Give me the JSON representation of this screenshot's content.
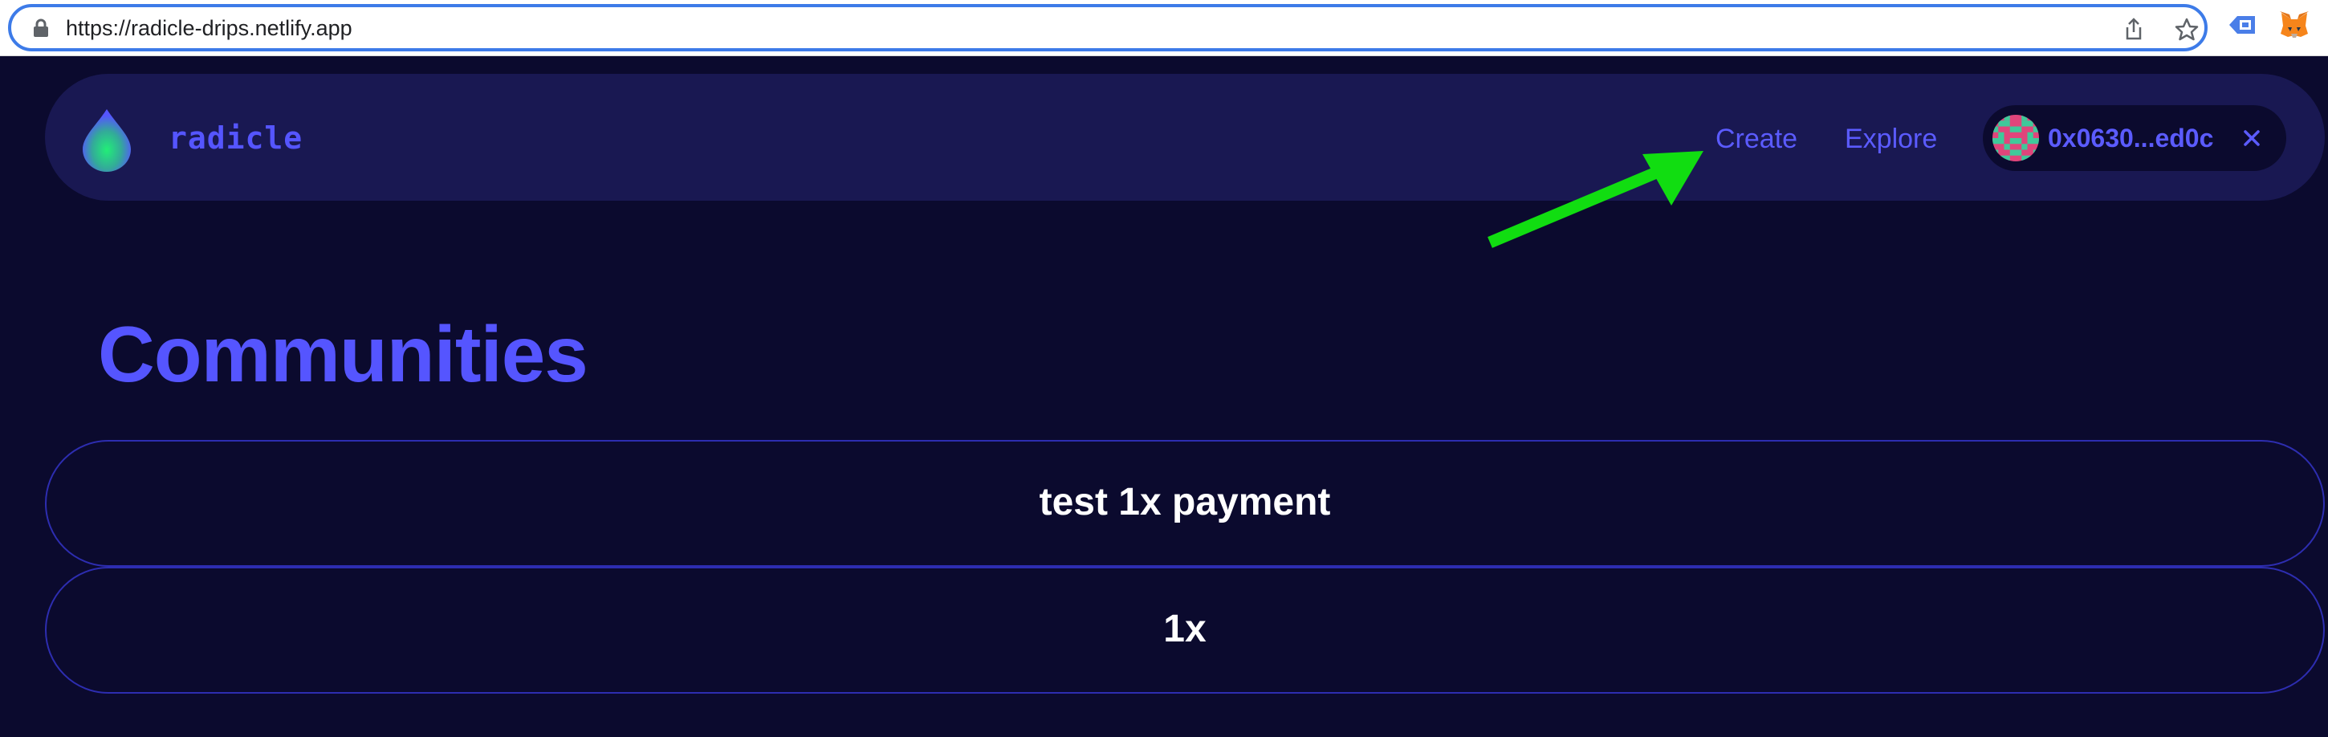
{
  "browser": {
    "url": "https://radicle-drips.netlify.app"
  },
  "nav": {
    "logo_text": "radicle",
    "links": [
      {
        "label": "Create"
      },
      {
        "label": "Explore"
      }
    ],
    "wallet": {
      "address": "0x0630...ed0c"
    }
  },
  "main": {
    "title": "Communities",
    "communities": [
      {
        "name": "test 1x payment"
      },
      {
        "name": "1x"
      }
    ]
  },
  "colors": {
    "background": "#0b0a2e",
    "nav_background": "#191852",
    "accent": "#5555ff",
    "card_border": "#2d2db0",
    "annotation_arrow": "#11dd11"
  },
  "icons": [
    "lock-icon",
    "share-icon",
    "star-icon",
    "extension-icon",
    "metamask-fox-icon",
    "radicle-logo-icon",
    "close-icon"
  ]
}
